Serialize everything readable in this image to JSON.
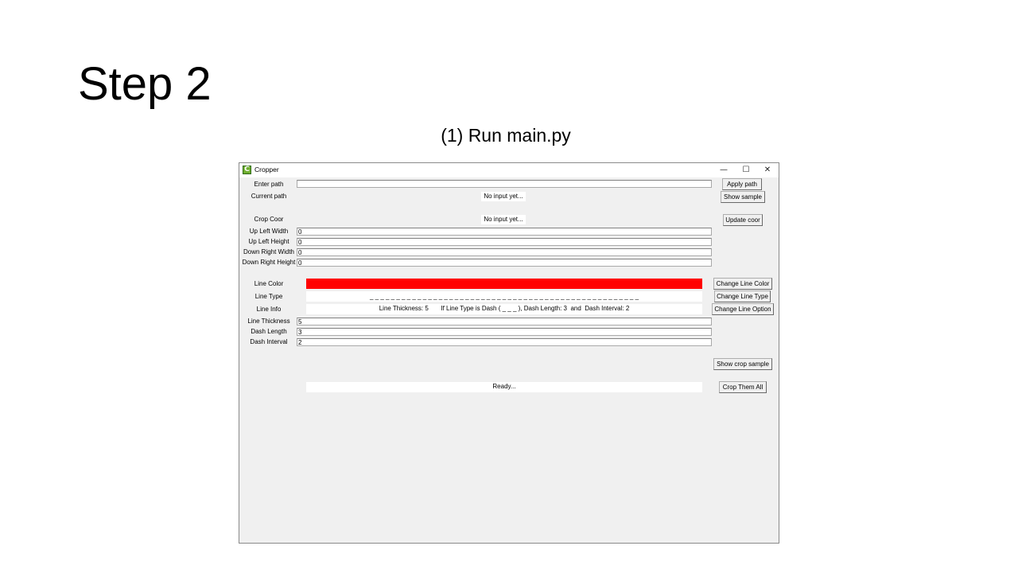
{
  "slide": {
    "title": "Step 2",
    "subtitle": "(1) Run main.py"
  },
  "window": {
    "title": "Cropper",
    "app_icon_letter": "C",
    "minimize": "—",
    "maximize": "☐",
    "close": "✕"
  },
  "path": {
    "enter_label": "Enter path",
    "enter_value": "",
    "apply_button": "Apply path",
    "current_label": "Current path",
    "current_value": "No input yet...",
    "show_sample_button": "Show sample"
  },
  "crop": {
    "coor_label": "Crop Coor",
    "coor_value": "No input yet...",
    "update_button": "Update coor",
    "fields": [
      {
        "label": "Up Left Width",
        "value": "0"
      },
      {
        "label": "Up Left Height",
        "value": "0"
      },
      {
        "label": "Down Right Width",
        "value": "0"
      },
      {
        "label": "Down Right Height",
        "value": "0"
      }
    ]
  },
  "line": {
    "color_label": "Line Color",
    "color_value": "#ff0000",
    "change_color_button": "Change Line Color",
    "type_label": "Line Type",
    "type_value": "_ _ _ _ _ _ _ _ _ _ _ _ _ _ _ _ _ _ _ _ _ _ _ _ _ _ _ _ _ _ _ _ _ _ _ _ _ _ _ _ _ _ _ _ _ _ _ _ _ _ _",
    "change_type_button": "Change Line Type",
    "info_label": "Line Info",
    "info_value": "Line Thickness: 5       If Line Type is Dash ( _ _ _ ), Dash Length: 3  and  Dash Interval: 2",
    "change_option_button": "Change Line Option",
    "fields": [
      {
        "label": "Line Thickness",
        "value": "5"
      },
      {
        "label": "Dash Length",
        "value": "3"
      },
      {
        "label": "Dash Interval",
        "value": "2"
      }
    ]
  },
  "actions": {
    "show_crop_sample_button": "Show crop sample",
    "status": "Ready...",
    "crop_all_button": "Crop Them All"
  }
}
